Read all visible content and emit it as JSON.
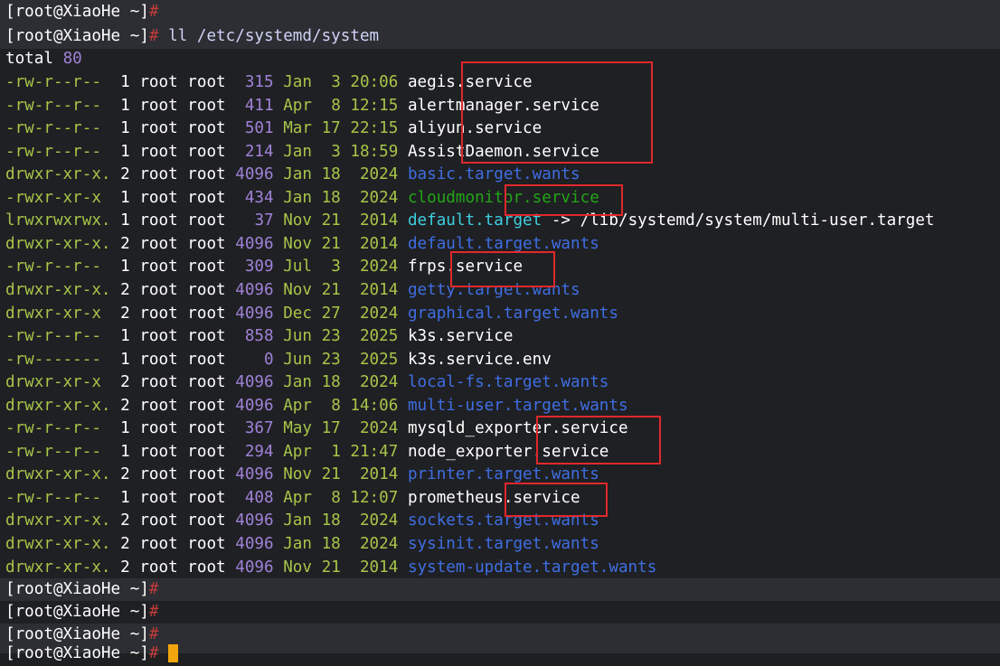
{
  "prompt": {
    "user_host": "root@XiaoHe",
    "dir": "~",
    "hash": "#"
  },
  "command": "ll /etc/systemd/system",
  "total": {
    "label": "total",
    "value": "80"
  },
  "entries": [
    {
      "perms": "-rw-r--r--",
      "links": "1",
      "owner": "root",
      "group": "root",
      "size": "315",
      "month": "Jan",
      "day": "3",
      "time": "20:06",
      "name": "aegis.service",
      "kind": "file"
    },
    {
      "perms": "-rw-r--r--",
      "links": "1",
      "owner": "root",
      "group": "root",
      "size": "411",
      "month": "Apr",
      "day": "8",
      "time": "12:15",
      "name": "alertmanager.service",
      "kind": "file"
    },
    {
      "perms": "-rw-r--r--",
      "links": "1",
      "owner": "root",
      "group": "root",
      "size": "501",
      "month": "Mar",
      "day": "17",
      "time": "22:15",
      "name": "aliyun.service",
      "kind": "file"
    },
    {
      "perms": "-rw-r--r--",
      "links": "1",
      "owner": "root",
      "group": "root",
      "size": "214",
      "month": "Jan",
      "day": "3",
      "time": "18:59",
      "name": "AssistDaemon.service",
      "kind": "file"
    },
    {
      "perms": "drwxr-xr-x.",
      "links": "2",
      "owner": "root",
      "group": "root",
      "size": "4096",
      "month": "Jan",
      "day": "18",
      "time": "2024",
      "name": "basic.target.wants",
      "kind": "dir"
    },
    {
      "perms": "-rwxr-xr-x",
      "links": "1",
      "owner": "root",
      "group": "root",
      "size": "434",
      "month": "Jan",
      "day": "18",
      "time": "2024",
      "name": "cloudmonitor.service",
      "kind": "exec"
    },
    {
      "perms": "lrwxrwxrwx.",
      "links": "1",
      "owner": "root",
      "group": "root",
      "size": "37",
      "month": "Nov",
      "day": "21",
      "time": "2014",
      "name": "default.target",
      "kind": "link",
      "arrow": "->",
      "target": "/lib/systemd/system/multi-user.target"
    },
    {
      "perms": "drwxr-xr-x.",
      "links": "2",
      "owner": "root",
      "group": "root",
      "size": "4096",
      "month": "Nov",
      "day": "21",
      "time": "2014",
      "name": "default.target.wants",
      "kind": "dir"
    },
    {
      "perms": "-rw-r--r--",
      "links": "1",
      "owner": "root",
      "group": "root",
      "size": "309",
      "month": "Jul",
      "day": "3",
      "time": "2024",
      "name": "frps.service",
      "kind": "file"
    },
    {
      "perms": "drwxr-xr-x.",
      "links": "2",
      "owner": "root",
      "group": "root",
      "size": "4096",
      "month": "Nov",
      "day": "21",
      "time": "2014",
      "name": "getty.target.wants",
      "kind": "dir"
    },
    {
      "perms": "drwxr-xr-x",
      "links": "2",
      "owner": "root",
      "group": "root",
      "size": "4096",
      "month": "Dec",
      "day": "27",
      "time": "2024",
      "name": "graphical.target.wants",
      "kind": "dir"
    },
    {
      "perms": "-rw-r--r--",
      "links": "1",
      "owner": "root",
      "group": "root",
      "size": "858",
      "month": "Jun",
      "day": "23",
      "time": "2025",
      "name": "k3s.service",
      "kind": "file"
    },
    {
      "perms": "-rw-------",
      "links": "1",
      "owner": "root",
      "group": "root",
      "size": "0",
      "month": "Jun",
      "day": "23",
      "time": "2025",
      "name": "k3s.service.env",
      "kind": "file"
    },
    {
      "perms": "drwxr-xr-x",
      "links": "2",
      "owner": "root",
      "group": "root",
      "size": "4096",
      "month": "Jan",
      "day": "18",
      "time": "2024",
      "name": "local-fs.target.wants",
      "kind": "dir"
    },
    {
      "perms": "drwxr-xr-x.",
      "links": "2",
      "owner": "root",
      "group": "root",
      "size": "4096",
      "month": "Apr",
      "day": "8",
      "time": "14:06",
      "name": "multi-user.target.wants",
      "kind": "dir"
    },
    {
      "perms": "-rw-r--r--",
      "links": "1",
      "owner": "root",
      "group": "root",
      "size": "367",
      "month": "May",
      "day": "17",
      "time": "2024",
      "name": "mysqld_exporter.service",
      "kind": "file"
    },
    {
      "perms": "-rw-r--r--",
      "links": "1",
      "owner": "root",
      "group": "root",
      "size": "294",
      "month": "Apr",
      "day": "1",
      "time": "21:47",
      "name": "node_exporter.service",
      "kind": "file"
    },
    {
      "perms": "drwxr-xr-x.",
      "links": "2",
      "owner": "root",
      "group": "root",
      "size": "4096",
      "month": "Nov",
      "day": "21",
      "time": "2014",
      "name": "printer.target.wants",
      "kind": "dir"
    },
    {
      "perms": "-rw-r--r--",
      "links": "1",
      "owner": "root",
      "group": "root",
      "size": "408",
      "month": "Apr",
      "day": "8",
      "time": "12:07",
      "name": "prometheus.service",
      "kind": "file"
    },
    {
      "perms": "drwxr-xr-x.",
      "links": "2",
      "owner": "root",
      "group": "root",
      "size": "4096",
      "month": "Jan",
      "day": "18",
      "time": "2024",
      "name": "sockets.target.wants",
      "kind": "dir"
    },
    {
      "perms": "drwxr-xr-x.",
      "links": "2",
      "owner": "root",
      "group": "root",
      "size": "4096",
      "month": "Jan",
      "day": "18",
      "time": "2024",
      "name": "sysinit.target.wants",
      "kind": "dir"
    },
    {
      "perms": "drwxr-xr-x.",
      "links": "2",
      "owner": "root",
      "group": "root",
      "size": "4096",
      "month": "Nov",
      "day": "21",
      "time": "2014",
      "name": "system-update.target.wants",
      "kind": "dir"
    }
  ],
  "colors": {
    "background": "#1d1f21",
    "permissions": "#a6c549",
    "size": "#a082d8",
    "directory": "#3f6ee3",
    "executable": "#22a617",
    "symlink": "#3ecfe1",
    "prompt_hash": "#c23b3b",
    "annotation_box": "#e0282b",
    "cursor": "#f2a50c"
  }
}
